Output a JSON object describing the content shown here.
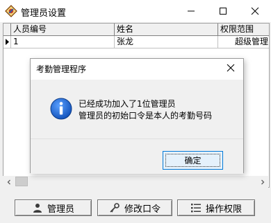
{
  "window": {
    "title": "管理员设置"
  },
  "grid": {
    "columns": [
      "人员编号",
      "姓名",
      "权限范围"
    ],
    "rows": [
      {
        "id": "1",
        "name": "张龙",
        "scope": "超级管理"
      }
    ]
  },
  "buttons": {
    "admin": "管理员",
    "change_password": "修改口令",
    "permissions": "操作权限"
  },
  "dialog": {
    "title": "考勤管理程序",
    "line1": "已经成功加入了1位管理员",
    "line2": "管理员的初始口令是本人的考勤号码",
    "ok": "确定"
  }
}
